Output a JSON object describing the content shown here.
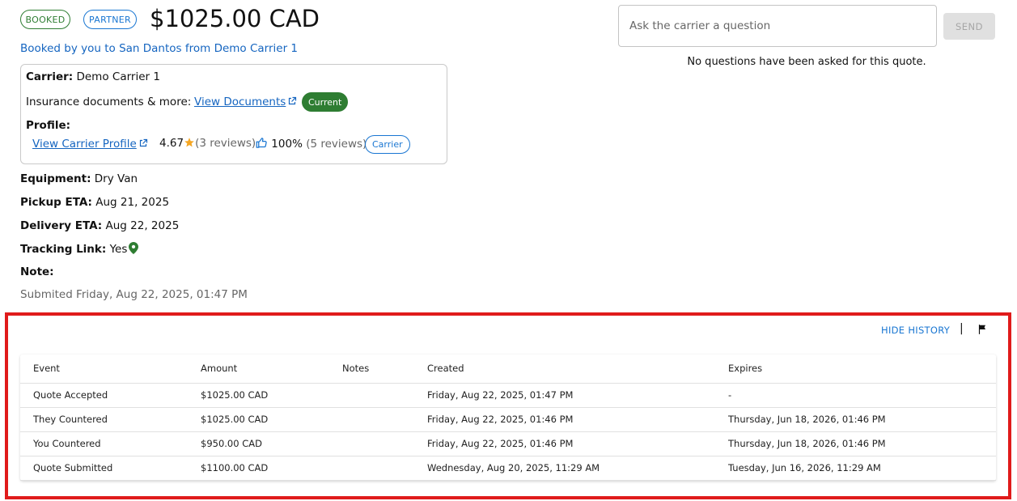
{
  "header": {
    "badge_booked": "BOOKED",
    "badge_partner": "PARTNER",
    "price": "$1025.00 CAD",
    "booked_by": "Booked by you to San Dantos from Demo Carrier 1"
  },
  "carrier_card": {
    "carrier_label": "Carrier:",
    "carrier_name": "Demo Carrier 1",
    "insurance_label": "Insurance documents & more:",
    "view_documents": "View Documents",
    "current_badge": "Current",
    "profile_label": "Profile:",
    "view_profile": "View Carrier Profile",
    "rating": "4.67",
    "rating_reviews": "(3 reviews)",
    "approval": "100%",
    "approval_reviews": "(5 reviews)",
    "carrier_chip": "Carrier"
  },
  "details": {
    "equipment_label": "Equipment:",
    "equipment": "Dry Van",
    "pickup_label": "Pickup ETA:",
    "pickup": "Aug 21, 2025",
    "delivery_label": "Delivery ETA:",
    "delivery": "Aug 22, 2025",
    "tracking_label": "Tracking Link:",
    "tracking": "Yes",
    "note_label": "Note:",
    "submitted": "Submited Friday, Aug 22, 2025, 01:47 PM"
  },
  "questions": {
    "placeholder": "Ask the carrier a question",
    "send_label": "SEND",
    "empty_text": "No questions have been asked for this quote."
  },
  "history": {
    "hide_label": "HIDE HISTORY",
    "separator": "|",
    "columns": [
      "Event",
      "Amount",
      "Notes",
      "Created",
      "Expires"
    ],
    "rows": [
      [
        "Quote Accepted",
        "$1025.00 CAD",
        "",
        "Friday, Aug 22, 2025, 01:47 PM",
        "-"
      ],
      [
        "They Countered",
        "$1025.00 CAD",
        "",
        "Friday, Aug 22, 2025, 01:46 PM",
        "Thursday, Jun 18, 2026, 01:46 PM"
      ],
      [
        "You Countered",
        "$950.00 CAD",
        "",
        "Friday, Aug 22, 2025, 01:46 PM",
        "Thursday, Jun 18, 2026, 01:46 PM"
      ],
      [
        "Quote Submitted",
        "$1100.00 CAD",
        "",
        "Wednesday, Aug 20, 2025, 11:29 AM",
        "Tuesday, Jun 16, 2026, 11:29 AM"
      ]
    ]
  },
  "colors": {
    "booked": "#2e7d32",
    "partner": "#1976d2",
    "link": "#1565c0",
    "star": "#f5a623",
    "highlight_frame": "#e01b1b"
  }
}
